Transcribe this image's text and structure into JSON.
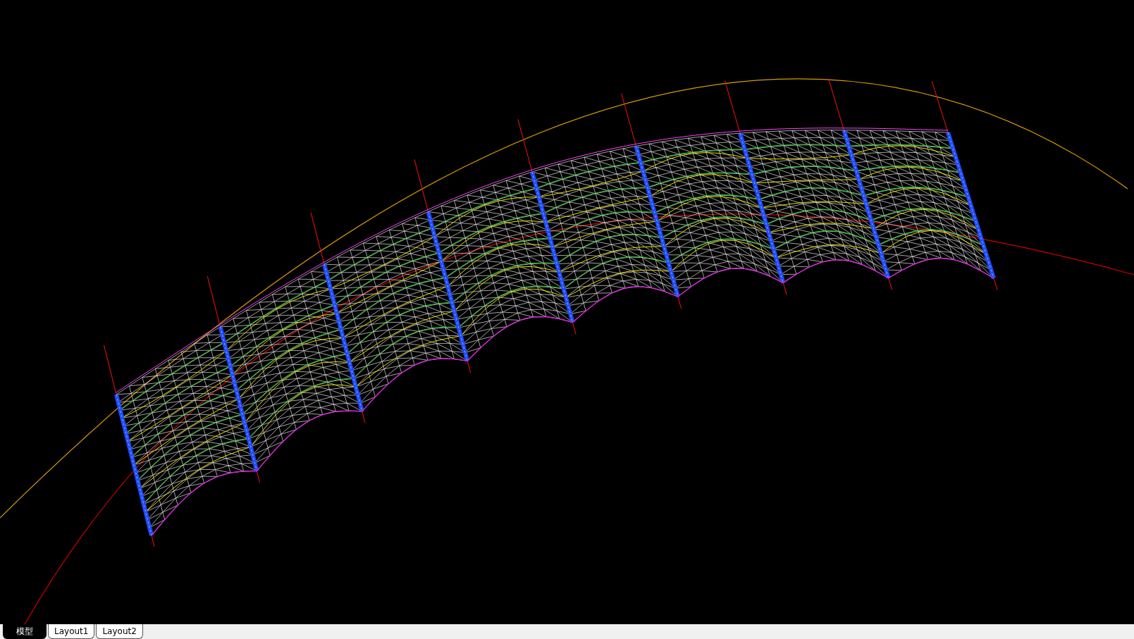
{
  "layout_tabs": [
    {
      "label": "模型",
      "selected": true
    },
    {
      "label": "Layout1",
      "selected": false
    },
    {
      "label": "Layout2",
      "selected": false
    }
  ]
}
